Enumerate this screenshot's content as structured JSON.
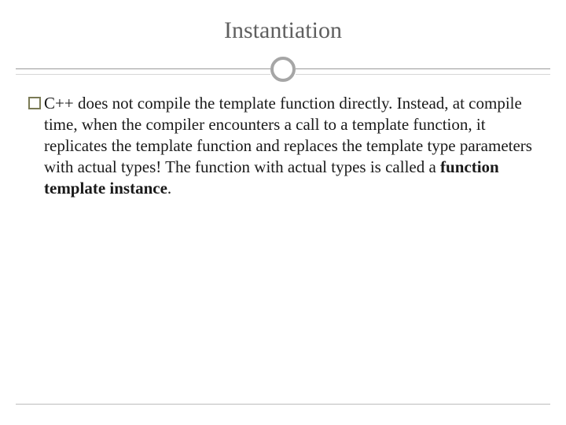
{
  "slide": {
    "title": "Instantiation",
    "bullet_icon": "square-outline-icon",
    "body": {
      "part1": "C++ does not compile the template function directly. Instead, at compile time, when the compiler encounters a call to a template function, it replicates the template function and replaces the template type parameters with actual types! The function with actual types is called a ",
      "bold": "function template instance",
      "part2": "."
    }
  }
}
